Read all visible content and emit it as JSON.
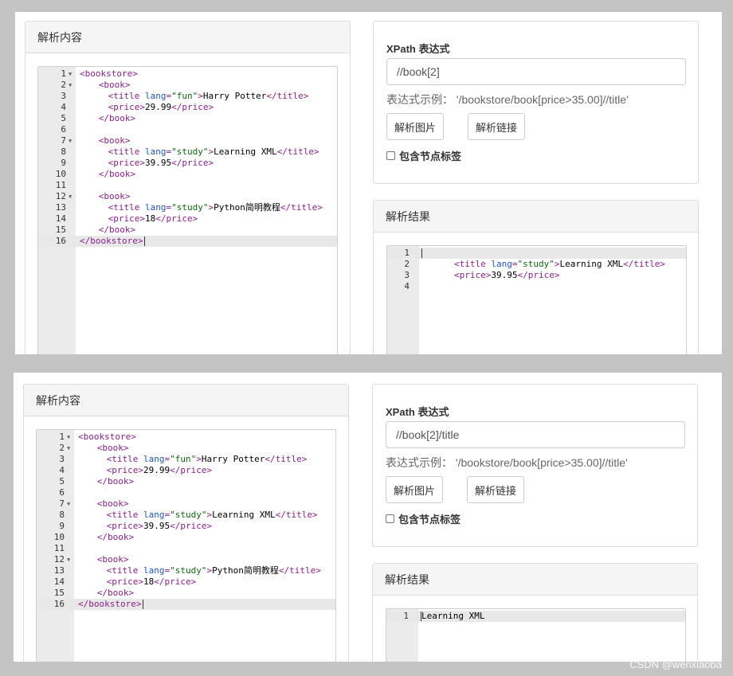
{
  "panels": {
    "content_title": "解析内容",
    "result_title": "解析结果"
  },
  "xpath": {
    "label": "XPath 表达式",
    "hint_prefix": "表达式示例：",
    "hint_example": "'/bookstore/book[price>35.00]//title'",
    "parse_image_button": "解析图片",
    "parse_link_button": "解析链接",
    "include_tag_label": "包含节点标签"
  },
  "screenshots": [
    {
      "xpath_value": "//book[2]",
      "result_lines": [
        "",
        "<title lang=\"study\">Learning XML</title>",
        "<price>39.95</price>",
        ""
      ]
    },
    {
      "xpath_value": "//book[2]/title",
      "result_lines": [
        "Learning XML"
      ]
    }
  ],
  "source_lines": [
    "<bookstore>",
    "<book>",
    "<title lang=\"fun\">Harry Potter</title>",
    "<price>29.99</price>",
    "</book>",
    "",
    "<book>",
    "<title lang=\"study\">Learning XML</title>",
    "<price>39.95</price>",
    "</book>",
    "",
    "<book>",
    "<title lang=\"study\">Python简明教程</title>",
    "<price>18</price>",
    "</book>",
    "</bookstore>"
  ],
  "watermark": "CSDN @wenxiaoba"
}
